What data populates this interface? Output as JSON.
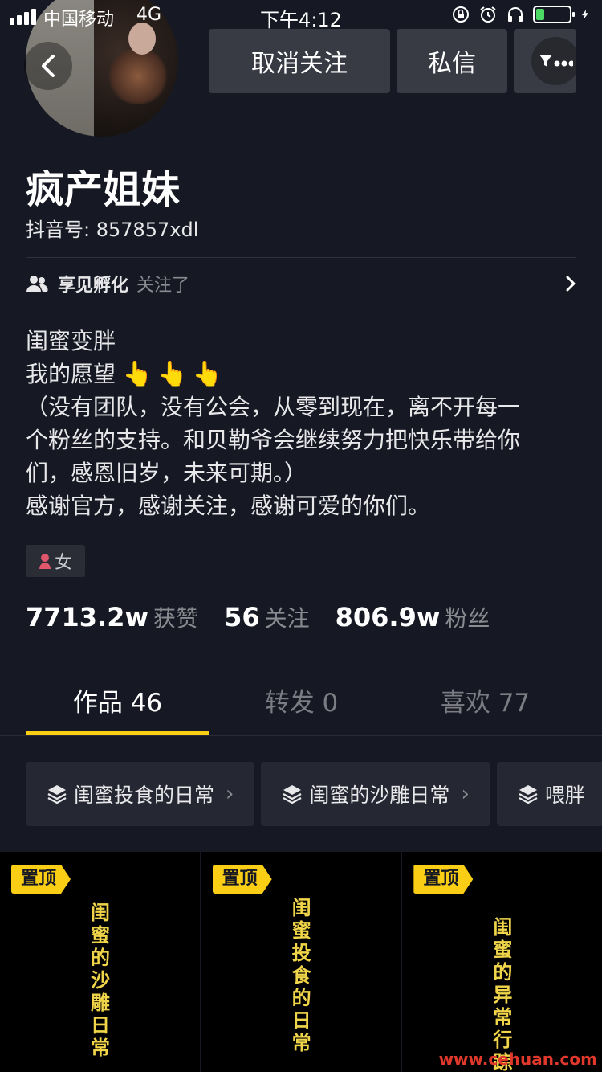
{
  "status_bar": {
    "carrier": "中国移动",
    "network": "4G",
    "time": "下午4:12",
    "battery_level": 0.25
  },
  "header": {
    "unfollow_label": "取消关注",
    "message_label": "私信"
  },
  "profile": {
    "nickname": "疯产姐妹",
    "douyin_id": "抖音号: 857857xdl",
    "mutual_name": "享见孵化",
    "mutual_suffix": "关注了",
    "bio": [
      "闺蜜变胖",
      "我的愿望",
      "（没有团队，没有公会，从零到现在，离不开每一",
      "个粉丝的支持。和贝勒爷会继续努力把快乐带给你",
      "们，感恩旧岁，未来可期。）",
      "感谢官方，感谢关注，感谢可爱的你们。"
    ],
    "gender": "女"
  },
  "stats": [
    {
      "value": "7713.2w",
      "label": "获赞"
    },
    {
      "value": "56",
      "label": "关注"
    },
    {
      "value": "806.9w",
      "label": "粉丝"
    }
  ],
  "tabs": [
    {
      "label": "作品 46"
    },
    {
      "label": "转发 0"
    },
    {
      "label": "喜欢 77"
    }
  ],
  "collections": [
    {
      "label": "闺蜜投食的日常"
    },
    {
      "label": "闺蜜的沙雕日常"
    },
    {
      "label": "喂胖"
    }
  ],
  "videos": [
    {
      "pin": "置顶",
      "title": "闺蜜的沙雕日常"
    },
    {
      "pin": "置顶",
      "title": "闺蜜投食的日常"
    },
    {
      "pin": "置顶",
      "title": "闺蜜的异常行踪"
    }
  ],
  "watermark": "www.cehuan.com",
  "colors": {
    "background": "#161823",
    "accent": "#face15",
    "button": "#393b44",
    "muted_text": "#8a8b91"
  }
}
